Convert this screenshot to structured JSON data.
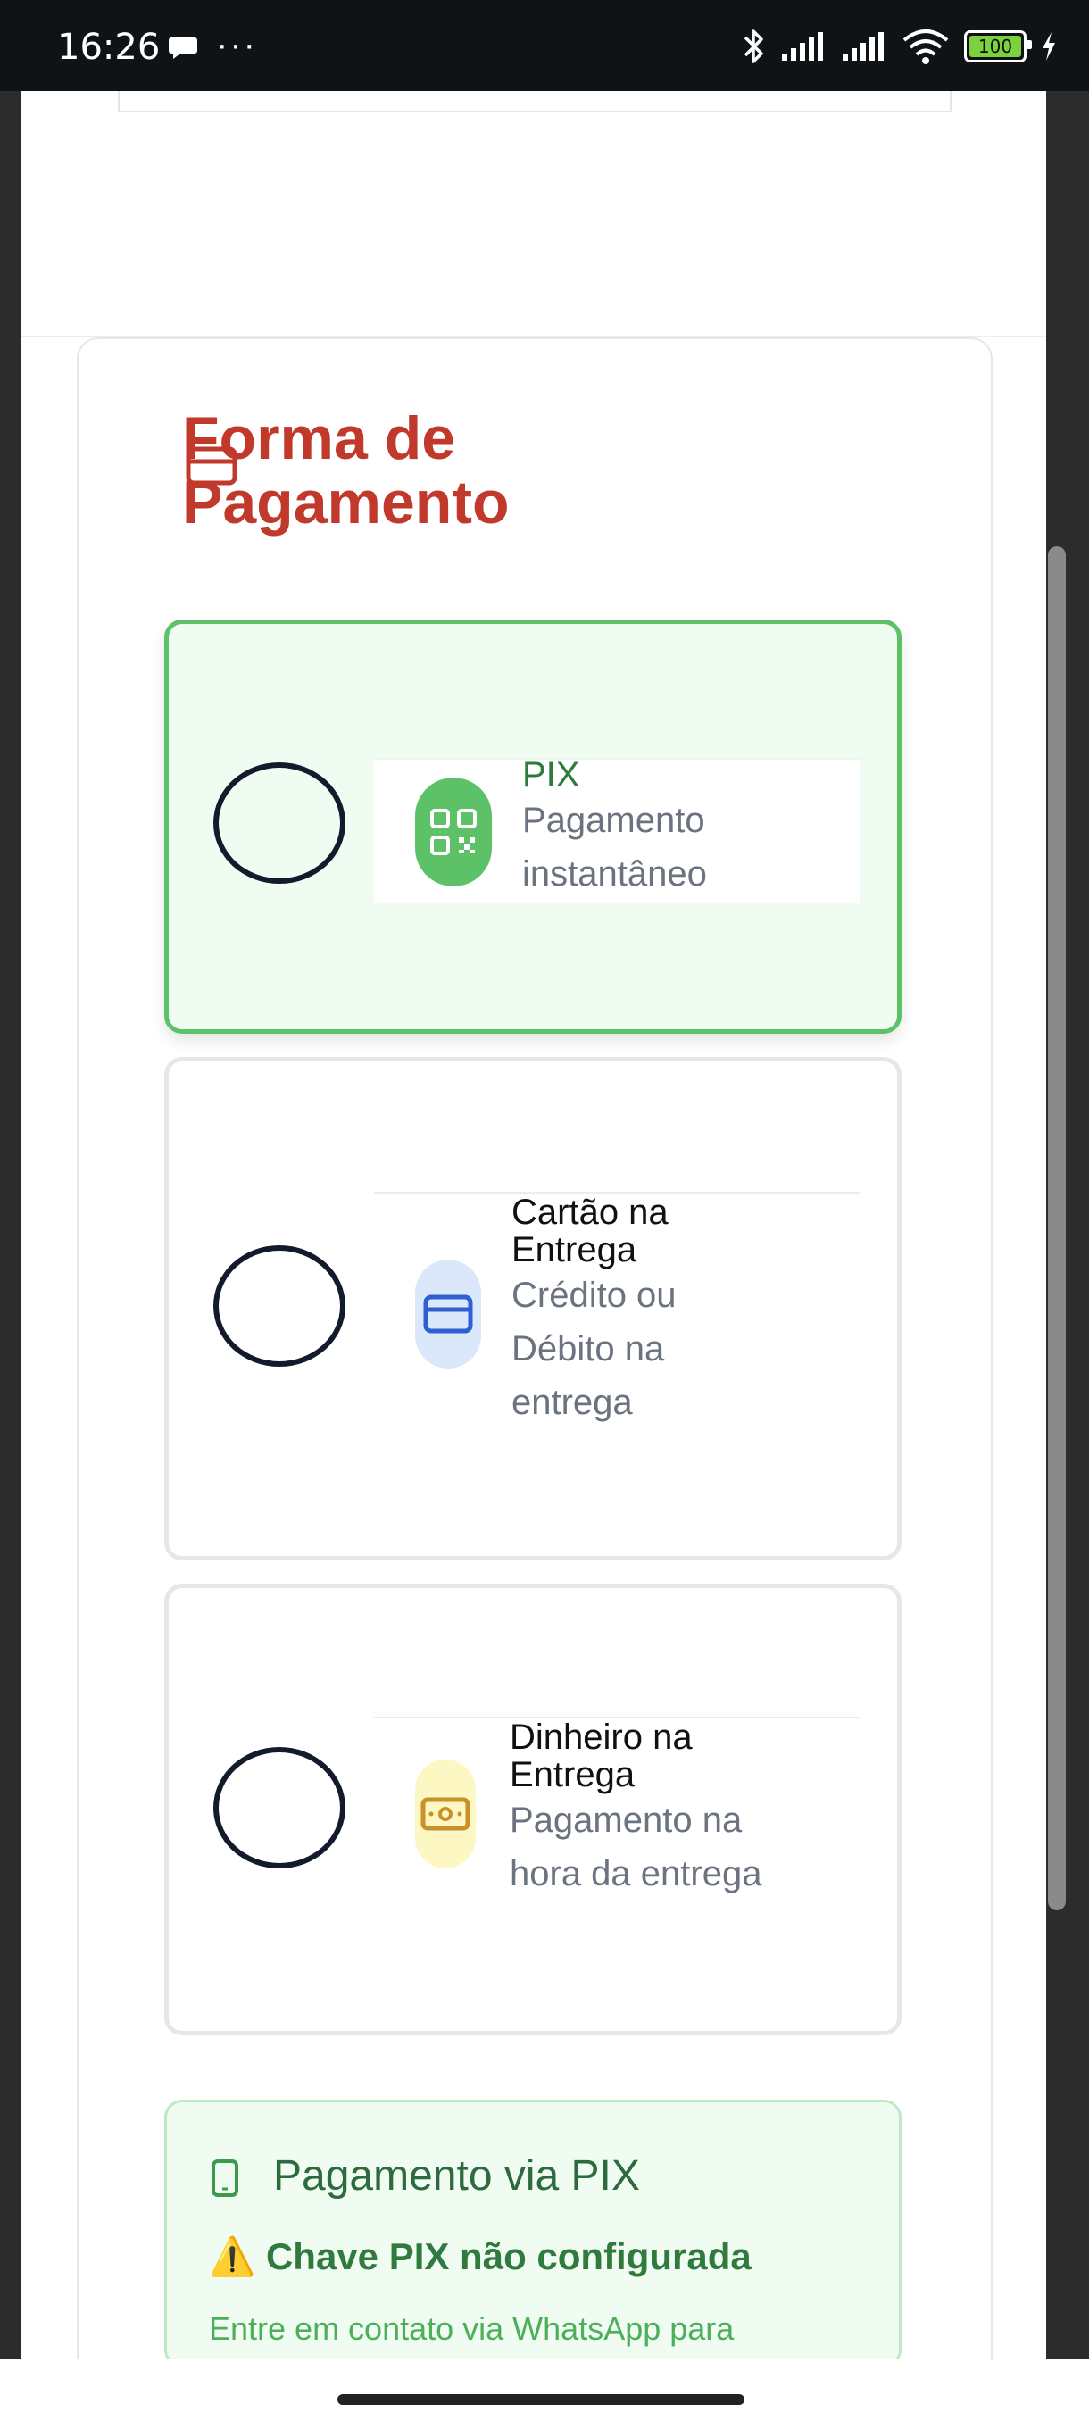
{
  "status_bar": {
    "time": "16:26",
    "more": "···",
    "battery_level": "100",
    "icons": [
      "chat-bubble-icon",
      "more-icon",
      "bluetooth-icon",
      "signal-icon",
      "signal-icon",
      "wifi-icon",
      "battery-icon",
      "charging-icon"
    ]
  },
  "payment": {
    "title": "Forma de Pagamento",
    "title_icon": "credit-card-icon",
    "options": [
      {
        "title": "PIX",
        "subtitle": "Pagamento instantâneo",
        "icon": "qr-code-icon",
        "selected": true,
        "icon_bg": "#5cc167",
        "icon_color": "#ffffff"
      },
      {
        "title": "Cartão na Entrega",
        "subtitle": "Crédito ou Débito na entrega",
        "icon": "credit-card-icon",
        "selected": false,
        "icon_bg": "#dbe8fc",
        "icon_color": "#2f5fd0"
      },
      {
        "title": "Dinheiro na Entrega",
        "subtitle": "Pagamento na hora da entrega",
        "icon": "cash-icon",
        "selected": false,
        "icon_bg": "#fdf7c3",
        "icon_color": "#c9912a"
      }
    ]
  },
  "pix_info": {
    "title": "Pagamento via PIX",
    "warning": "⚠️ Chave PIX não configurada",
    "description": "Entre em contato via WhatsApp para"
  },
  "colors": {
    "accent_red": "#c0392b",
    "selected_green": "#5cc167",
    "pix_bg": "#f0fbf2"
  }
}
